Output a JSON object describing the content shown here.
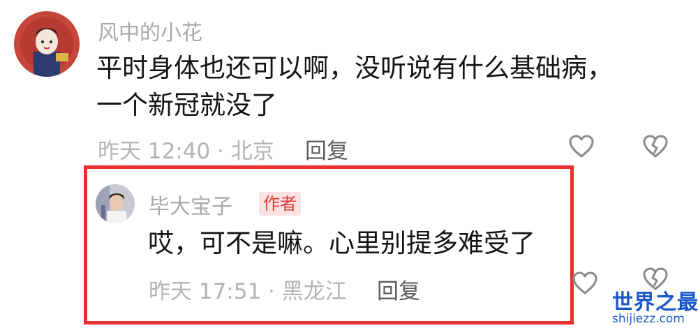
{
  "comment": {
    "username": "风中的小花",
    "text_line1": "平时身体也还可以啊，没听说有什么基础病，",
    "text_line2": "一个新冠就没了",
    "meta": "昨天 12:40 · 北京",
    "reply_label": "回复"
  },
  "reply": {
    "username": "毕大宝子",
    "author_badge": "作者",
    "text": "哎，可不是嘛。心里别提多难受了",
    "meta": "昨天 17:51 · 黑龙江",
    "reply_label": "回复"
  },
  "watermark": {
    "title": "世界之最",
    "url": "shijiezz.com"
  },
  "colors": {
    "highlight_border": "#e8312e",
    "badge_bg": "#fce3e3",
    "badge_text": "#e83a36",
    "watermark": "#1a57c8"
  },
  "icons": {
    "like": "heart-outline-icon",
    "dislike": "broken-heart-icon"
  }
}
